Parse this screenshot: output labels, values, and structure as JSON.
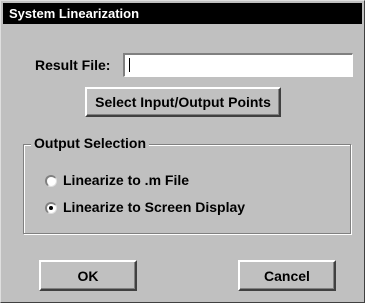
{
  "window": {
    "title": "System Linearization"
  },
  "result_file": {
    "label": "Result File:",
    "value": ""
  },
  "select_points_button": {
    "label": "Select Input/Output Points"
  },
  "output_selection": {
    "title": "Output Selection",
    "options": [
      {
        "label": "Linearize to .m File",
        "selected": false
      },
      {
        "label": "Linearize to Screen Display",
        "selected": true
      }
    ]
  },
  "buttons": {
    "ok_label": "OK",
    "cancel_label": "Cancel"
  }
}
